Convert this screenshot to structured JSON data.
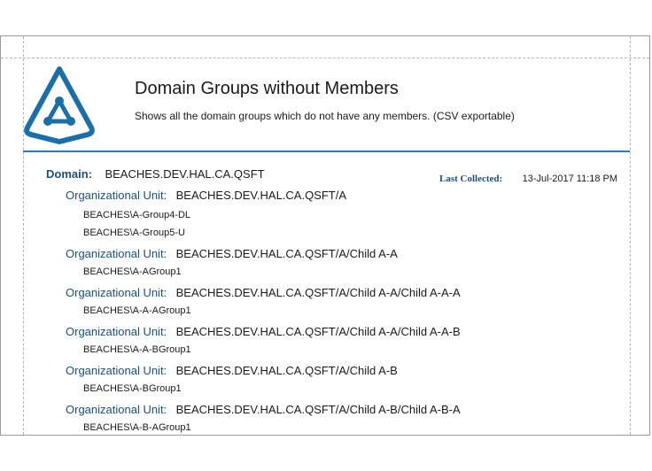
{
  "report": {
    "title": "Domain Groups without Members",
    "subtitle": "Shows all the domain groups which do not have any members. (CSV exportable)"
  },
  "domain": {
    "label": "Domain:",
    "value": "BEACHES.DEV.HAL.CA.QSFT",
    "last_collected_label": "Last Collected:",
    "last_collected_value": "13-Jul-2017 11:18 PM"
  },
  "ou_label": "Organizational Unit:",
  "ous": [
    {
      "path": "BEACHES.DEV.HAL.CA.QSFT/A",
      "groups": [
        "BEACHES\\A-Group4-DL",
        "BEACHES\\A-Group5-U"
      ]
    },
    {
      "path": "BEACHES.DEV.HAL.CA.QSFT/A/Child A-A",
      "groups": [
        "BEACHES\\A-AGroup1"
      ]
    },
    {
      "path": "BEACHES.DEV.HAL.CA.QSFT/A/Child A-A/Child A-A-A",
      "groups": [
        "BEACHES\\A-A-AGroup1"
      ]
    },
    {
      "path": "BEACHES.DEV.HAL.CA.QSFT/A/Child A-A/Child A-A-B",
      "groups": [
        "BEACHES\\A-A-BGroup1"
      ]
    },
    {
      "path": "BEACHES.DEV.HAL.CA.QSFT/A/Child A-B",
      "groups": [
        "BEACHES\\A-BGroup1"
      ]
    },
    {
      "path": "BEACHES.DEV.HAL.CA.QSFT/A/Child A-B/Child A-B-A",
      "groups": [
        "BEACHES\\A-B-AGroup1"
      ]
    }
  ],
  "colors": {
    "brand": "#1a6fa8",
    "label": "#1f4e79",
    "rule": "#2b7fb0"
  },
  "icons": {
    "logo": "triangle-logo-icon"
  }
}
